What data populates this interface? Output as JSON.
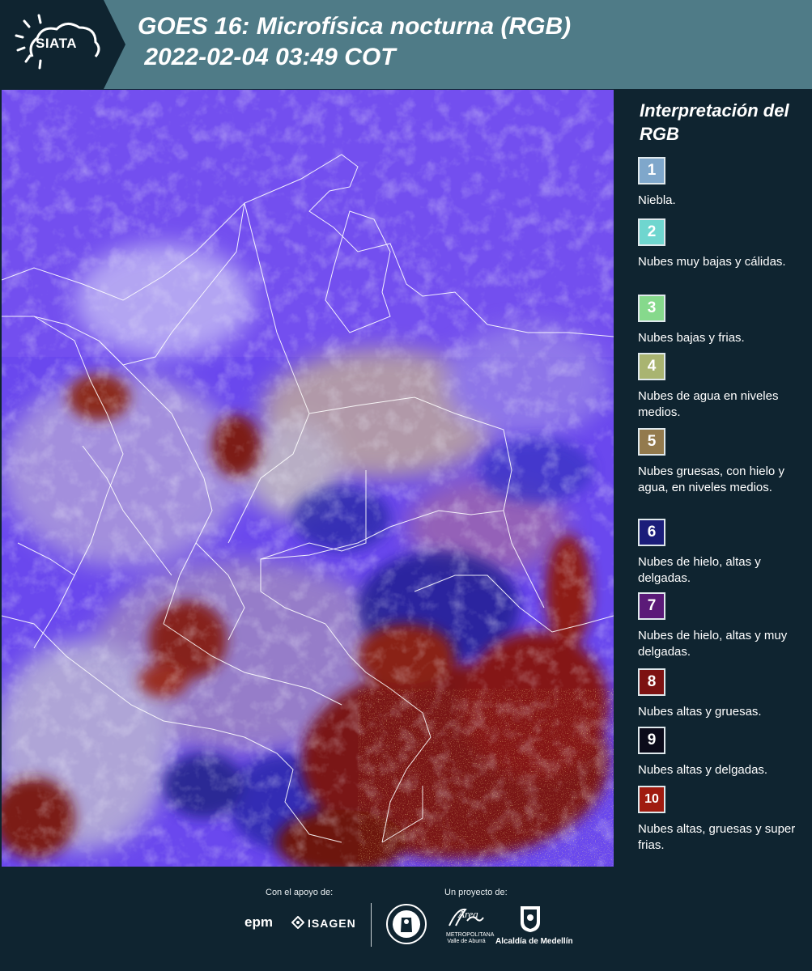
{
  "header": {
    "logo_text": "SIATA",
    "title_line1": "GOES 16: Microfísica nocturna (RGB)",
    "title_line2": " 2022-02-04 03:49 COT",
    "colors": {
      "header_bg": "#4f7b87",
      "logo_bg": "#0f2430"
    }
  },
  "map": {
    "description_icon": "satellite-rgb-map"
  },
  "legend": {
    "title": "Interpretación del RGB",
    "items": [
      {
        "num": "1",
        "label": "Niebla.",
        "color": "#7fa7cb"
      },
      {
        "num": "2",
        "label": "Nubes muy bajas y cálidas.",
        "color": "#6fd6cf"
      },
      {
        "num": "3",
        "label": "Nubes bajas y frias.",
        "color": "#86d98c"
      },
      {
        "num": "4",
        "label": "Nubes de agua en niveles medios.",
        "color": "#a9b471"
      },
      {
        "num": "5",
        "label": "Nubes gruesas, con hielo y agua, en niveles medios.",
        "color": "#937a4d"
      },
      {
        "num": "6",
        "label": "Nubes de hielo, altas y delgadas.",
        "color": "#1b1d7a"
      },
      {
        "num": "7",
        "label": "Nubes de hielo, altas y muy delgadas.",
        "color": "#5b1a78"
      },
      {
        "num": "8",
        "label": "Nubes altas y gruesas.",
        "color": "#7d1212"
      },
      {
        "num": "9",
        "label": "Nubes altas y delgadas.",
        "color": "#0b0b1a"
      },
      {
        "num": "10",
        "label": "Nubes altas, gruesas y super frias.",
        "color": "#a01b10"
      }
    ]
  },
  "footer": {
    "support_label": "Con el apoyo de:",
    "project_label": "Un proyecto de:",
    "sponsor1": "epm",
    "sponsor2": "ISAGEN",
    "metro_text": "METROPOLITANA Valle de Aburrá",
    "metro_script": "Área",
    "alcaldia": "Alcaldía de Medellín"
  }
}
